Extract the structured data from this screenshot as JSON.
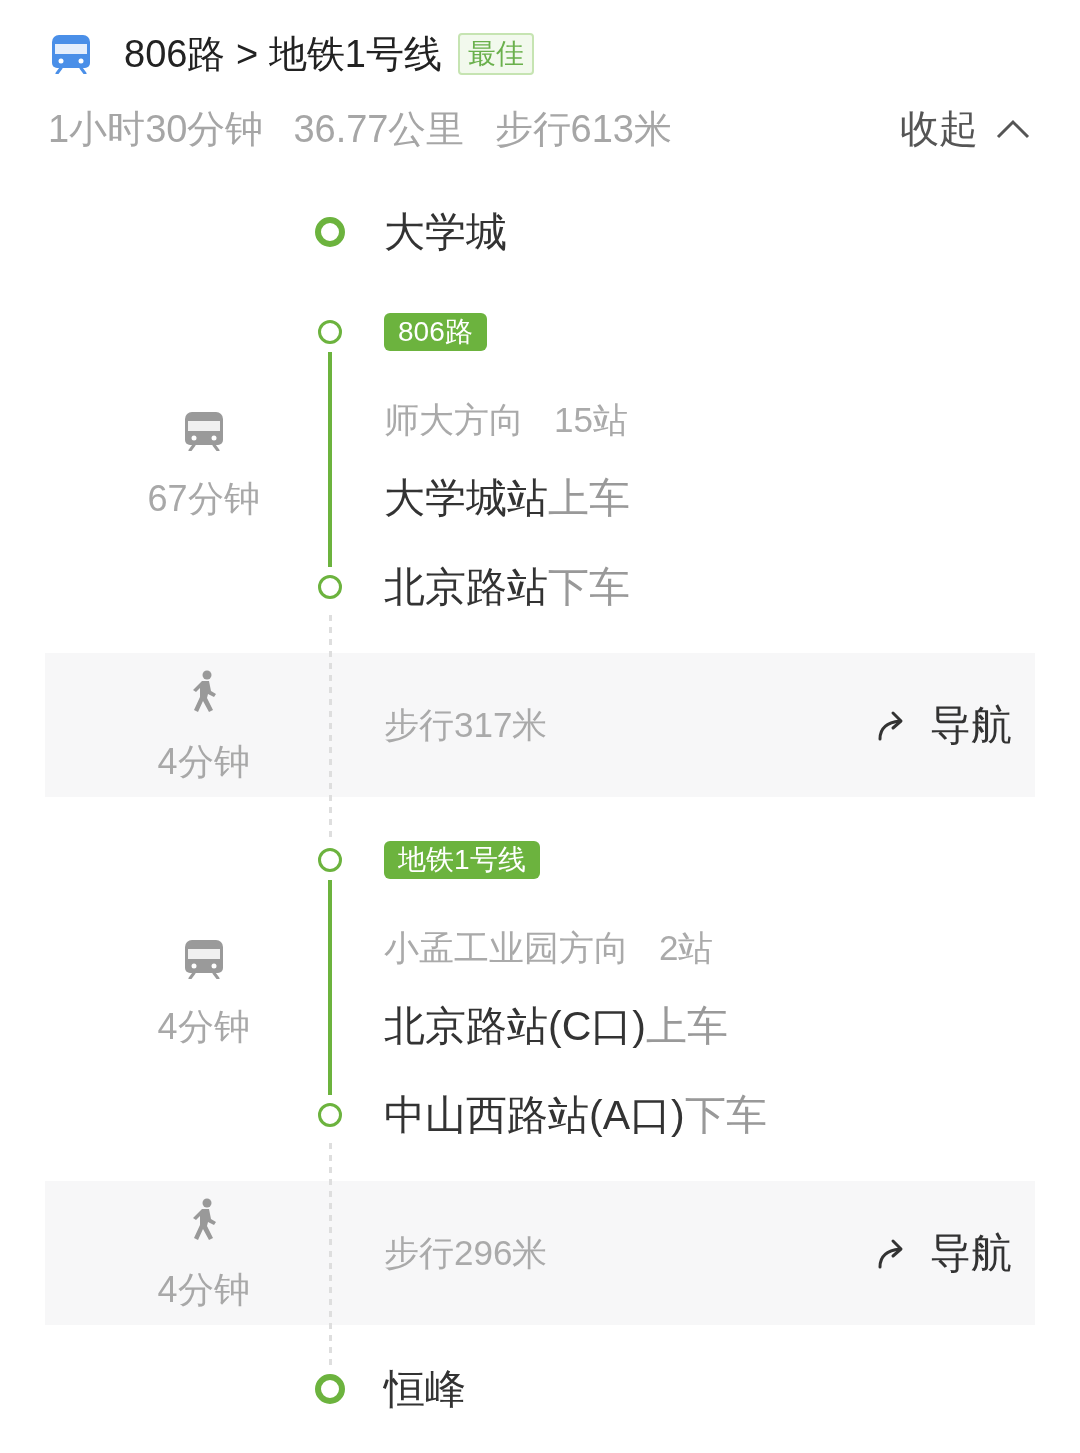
{
  "header": {
    "title": "806路 > 地铁1号线",
    "badge": "最佳"
  },
  "summary": {
    "items": [
      "1小时30分钟",
      "36.77公里",
      "步行613米"
    ],
    "toggle": {
      "label": "收起",
      "expanded": true
    }
  },
  "steps": [
    {
      "kind": "endpoint",
      "name": "大学城"
    },
    {
      "kind": "transit",
      "line": "806路",
      "direction": "师大方向",
      "stops": "15站",
      "duration": "67分钟",
      "board": {
        "station": "大学城站",
        "action": "上车"
      },
      "alight": {
        "station": "北京路站",
        "action": "下车"
      }
    },
    {
      "kind": "walk",
      "duration": "4分钟",
      "distance": "步行317米",
      "nav": "导航"
    },
    {
      "kind": "transit",
      "line": "地铁1号线",
      "direction": "小孟工业园方向",
      "stops": "2站",
      "duration": "4分钟",
      "board": {
        "station": "北京路站(C口)",
        "action": "上车"
      },
      "alight": {
        "station": "中山西路站(A口)",
        "action": "下车"
      }
    },
    {
      "kind": "walk",
      "duration": "4分钟",
      "distance": "步行296米",
      "nav": "导航"
    },
    {
      "kind": "endpoint",
      "name": "恒峰"
    }
  ]
}
